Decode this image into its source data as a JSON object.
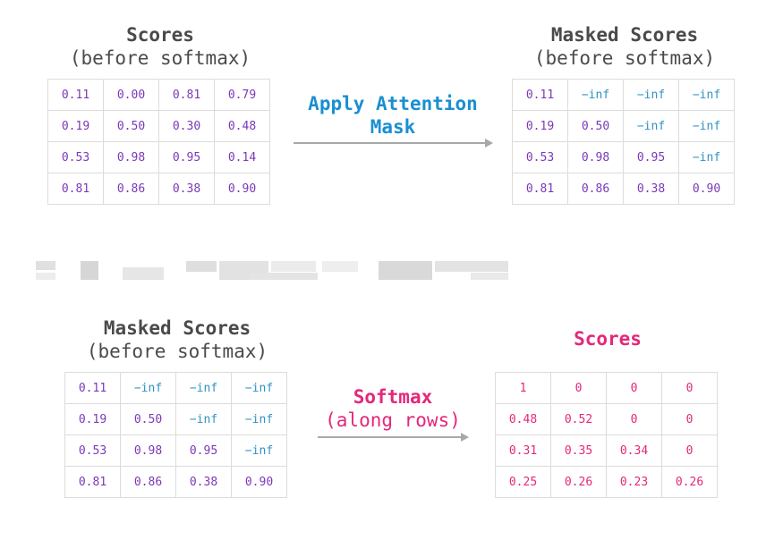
{
  "top": {
    "left_title": {
      "line1": "Scores",
      "line2": "(before softmax)"
    },
    "right_title": {
      "line1": "Masked Scores",
      "line2": "(before softmax)"
    },
    "operation": {
      "line1": "Apply Attention",
      "line2": "Mask",
      "color": "#1a8fd1"
    },
    "left_matrix": [
      [
        "0.11",
        "0.00",
        "0.81",
        "0.79"
      ],
      [
        "0.19",
        "0.50",
        "0.30",
        "0.48"
      ],
      [
        "0.53",
        "0.98",
        "0.95",
        "0.14"
      ],
      [
        "0.81",
        "0.86",
        "0.38",
        "0.90"
      ]
    ],
    "right_matrix": [
      [
        "0.11",
        "−inf",
        "−inf",
        "−inf"
      ],
      [
        "0.19",
        "0.50",
        "−inf",
        "−inf"
      ],
      [
        "0.53",
        "0.98",
        "0.95",
        "−inf"
      ],
      [
        "0.81",
        "0.86",
        "0.38",
        "0.90"
      ]
    ]
  },
  "bottom": {
    "left_title": {
      "line1": "Masked Scores",
      "line2": "(before softmax)"
    },
    "right_title": {
      "line1": "Scores",
      "line2": ""
    },
    "operation": {
      "line1": "Softmax",
      "line2": "(along rows)",
      "color": "#e5277a"
    },
    "left_matrix": [
      [
        "0.11",
        "−inf",
        "−inf",
        "−inf"
      ],
      [
        "0.19",
        "0.50",
        "−inf",
        "−inf"
      ],
      [
        "0.53",
        "0.98",
        "0.95",
        "−inf"
      ],
      [
        "0.81",
        "0.86",
        "0.38",
        "0.90"
      ]
    ],
    "right_matrix": [
      [
        "1",
        "0",
        "0",
        "0"
      ],
      [
        "0.48",
        "0.52",
        "0",
        "0"
      ],
      [
        "0.31",
        "0.35",
        "0.34",
        "0"
      ],
      [
        "0.25",
        "0.26",
        "0.23",
        "0.26"
      ]
    ]
  },
  "colors": {
    "title": "#4a4a4a",
    "number": "#7b38b8",
    "inf": "#2f93c4",
    "pink": "#e5277a",
    "arrow": "#a8a8a8",
    "cell_border": "#dcdcdc"
  }
}
